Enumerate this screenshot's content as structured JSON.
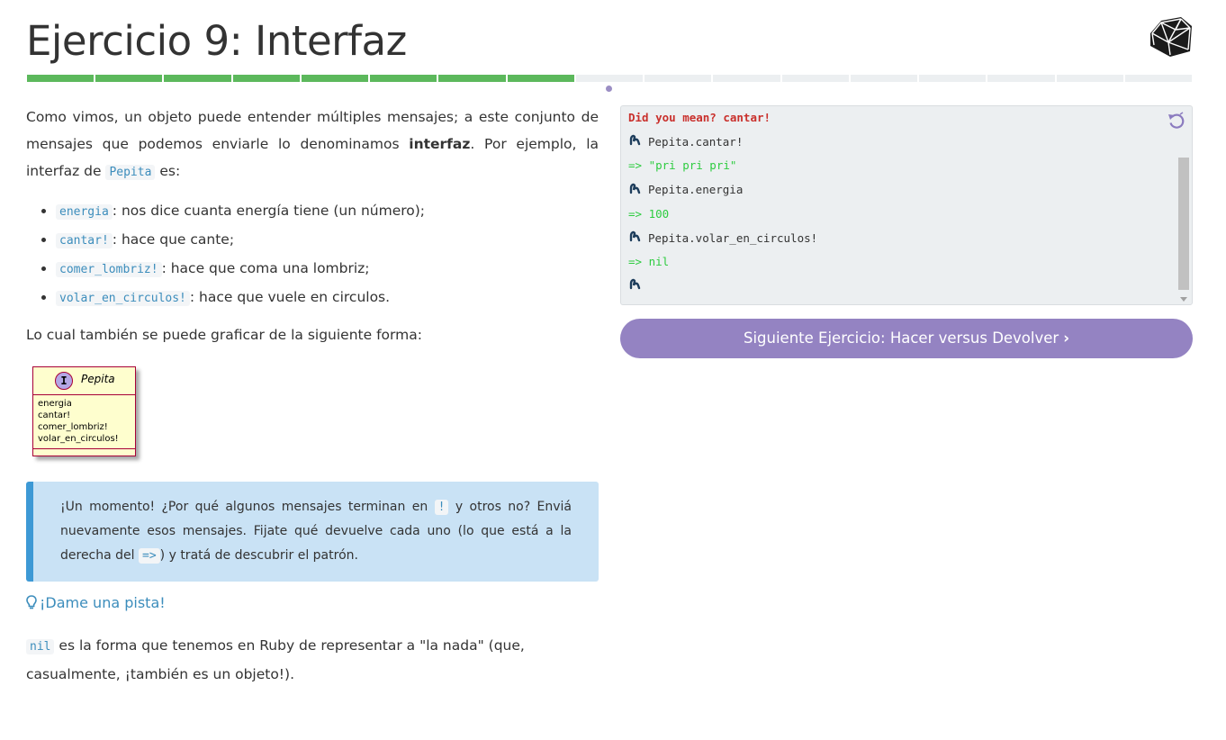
{
  "header": {
    "title": "Ejercicio 9: Interfaz"
  },
  "progress": {
    "total": 17,
    "completed": 8,
    "current": 9
  },
  "explanation": {
    "p1_a": "Como vimos, un objeto puede entender múltiples mensajes; a este conjunto de mensajes que podemos enviarle lo denominamos ",
    "p1_bold": "interfaz",
    "p1_b": ". Por ejemplo, la interfaz de ",
    "p1_code": "Pepita",
    "p1_c": " es:",
    "items": [
      {
        "code": "energia",
        "text": ": nos dice cuanta energía tiene (un número);"
      },
      {
        "code": "cantar!",
        "text": ": hace que cante;"
      },
      {
        "code": "comer_lombriz!",
        "text": ": hace que coma una lombriz;"
      },
      {
        "code": "volar_en_circulos!",
        "text": ": hace que vuele en circulos."
      }
    ],
    "p2": "Lo cual también se puede graficar de la siguiente forma:"
  },
  "uml": {
    "badge": "I",
    "name": "Pepita",
    "methods": [
      "energia",
      "cantar!",
      "comer_lombriz!",
      "volar_en_circulos!"
    ]
  },
  "tip": {
    "t1": "¡Un momento! ¿Por qué algunos mensajes terminan en ",
    "c1": "!",
    "t2": " y otros no? Enviá nuevamente esos mensajes. Fijate qué devuelve cada uno (lo que está a la derecha del ",
    "c2": "=>",
    "t3": ") y tratá de descubrir el patrón."
  },
  "hint": {
    "label": "¡Dame una pista!"
  },
  "nil_note": {
    "code": "nil",
    "text": " es la forma que tenemos en Ruby de representar a \"la nada\" (que, casualmente, ¡también es un objeto!)."
  },
  "console": {
    "lines": [
      {
        "kind": "error",
        "text": "Did you mean? cantar!"
      },
      {
        "kind": "command",
        "text": "Pepita.cantar!"
      },
      {
        "kind": "result",
        "text": "=> \"pri pri pri\""
      },
      {
        "kind": "command",
        "text": "Pepita.energia"
      },
      {
        "kind": "result",
        "text": "=> 100"
      },
      {
        "kind": "command",
        "text": "Pepita.volar_en_circulos!"
      },
      {
        "kind": "result",
        "text": "=> nil"
      },
      {
        "kind": "command",
        "text": ""
      }
    ]
  },
  "next": {
    "label": "Siguiente Ejercicio: Hacer versus Devolver"
  },
  "colors": {
    "progress_done": "#5cb85c",
    "progress_todo": "#eceff1",
    "accent": "#9483c2",
    "link": "#3c8dbc",
    "tip_bg": "#c9e2f5",
    "tip_border": "#3d99d5"
  }
}
